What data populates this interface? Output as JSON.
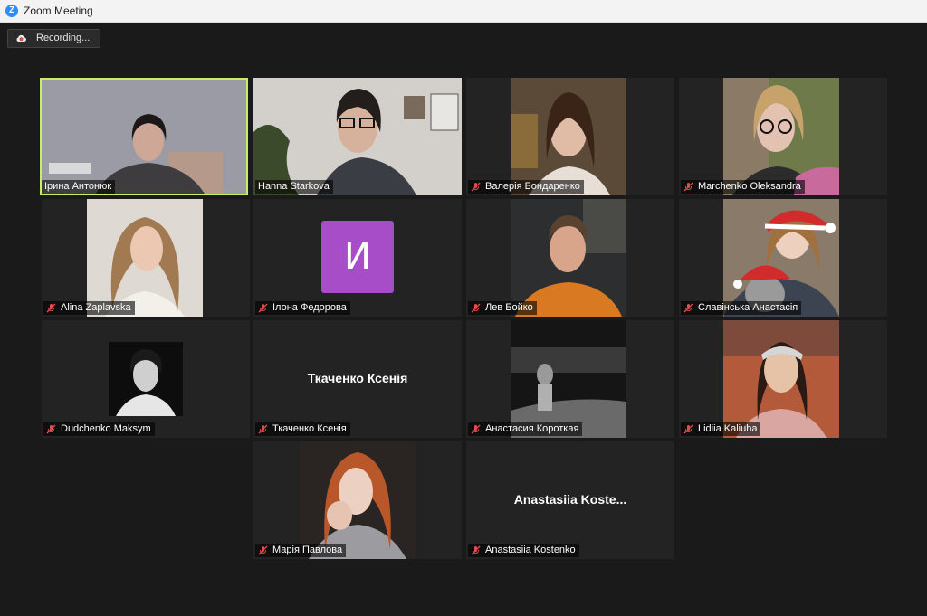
{
  "window": {
    "title": "Zoom Meeting",
    "app_icon": "zoom-logo-icon"
  },
  "recording": {
    "label": "Recording...",
    "icon": "record-cloud-icon",
    "color": "#d9534f"
  },
  "colors": {
    "active_speaker": "#c8ef63",
    "muted": "#e24c4b",
    "avatar_bg": "#a64dc7"
  },
  "participants": [
    {
      "name": "Ірина Антонюк",
      "muted": false,
      "active": true
    },
    {
      "name": "Hanna Starkova",
      "muted": false
    },
    {
      "name": "Валерія Бондаренко",
      "muted": true
    },
    {
      "name": "Marchenko Oleksandra",
      "muted": true
    },
    {
      "name": "Alina Zaplavska",
      "muted": true
    },
    {
      "name": "Ілона Федорова",
      "muted": true,
      "avatar_letter": "И"
    },
    {
      "name": "Лев Бойко",
      "muted": true
    },
    {
      "name": "Славінська Анастасія",
      "muted": true
    },
    {
      "name": "Dudchenko Maksym",
      "muted": true
    },
    {
      "name": "Ткаченко Ксенія",
      "muted": true,
      "video_name": "Ткаченко Ксенія"
    },
    {
      "name": "Анастасия Короткая",
      "muted": true
    },
    {
      "name": "Lidiia Kaliuha",
      "muted": true
    },
    {
      "name": "Марія Павлова",
      "muted": true
    },
    {
      "name": "Anastasiia Kostenko",
      "muted": true,
      "video_name": "Anastasiia  Koste..."
    }
  ]
}
